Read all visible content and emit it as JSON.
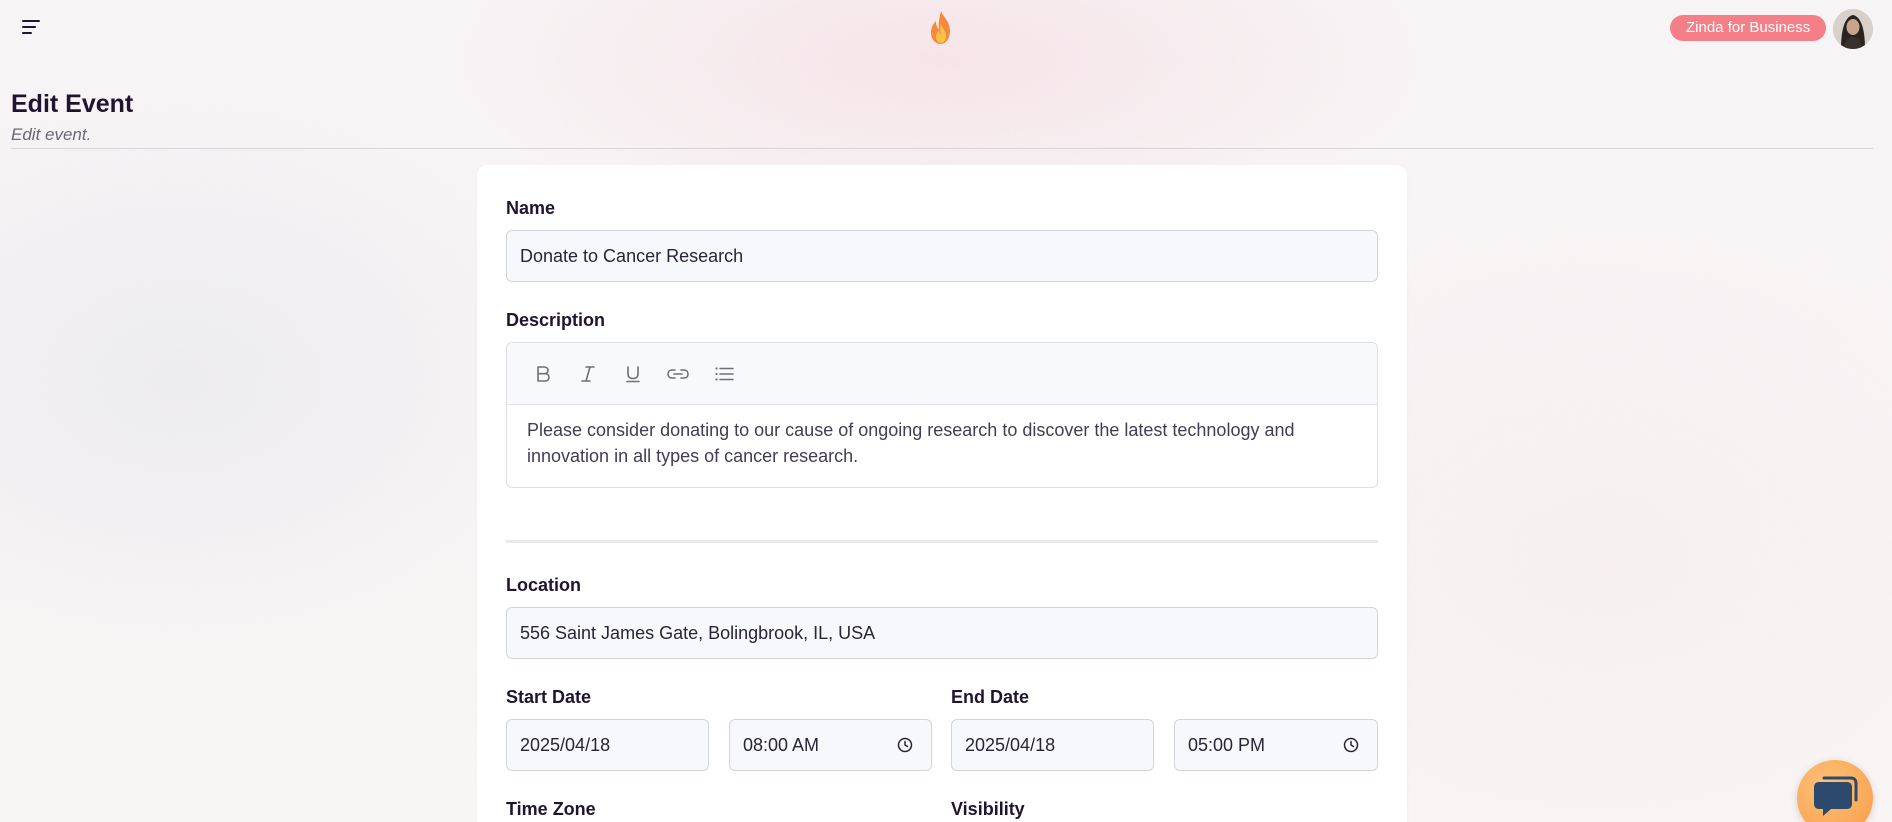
{
  "header": {
    "business_button_label": "Zinda for Business",
    "page_title": "Edit Event",
    "page_subtitle": "Edit event."
  },
  "form": {
    "name": {
      "label": "Name",
      "value": "Donate to Cancer Research"
    },
    "description": {
      "label": "Description",
      "toolbar": [
        "bold-icon",
        "italic-icon",
        "underline-icon",
        "link-icon",
        "bullet-list-icon"
      ],
      "text": "Please consider donating to our cause of ongoing research to discover the latest technology and innovation in all types of cancer research."
    },
    "location": {
      "label": "Location",
      "value": "556 Saint James Gate, Bolingbrook, IL, USA"
    },
    "start_date": {
      "label": "Start Date",
      "date": "2025/04/18",
      "time": "08:00 AM"
    },
    "end_date": {
      "label": "End Date",
      "date": "2025/04/18",
      "time": "05:00 PM"
    },
    "time_zone": {
      "label": "Time Zone"
    },
    "visibility": {
      "label": "Visibility"
    }
  },
  "colors": {
    "accent": "#f47f86",
    "logo_flame": "#f58a3a",
    "chat_button": "#f79b45"
  }
}
